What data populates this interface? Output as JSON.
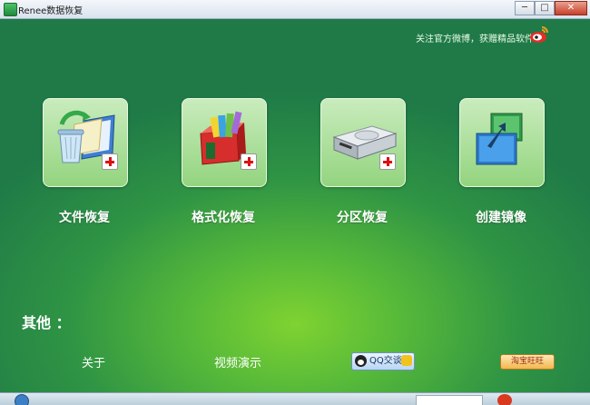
{
  "window": {
    "title": "Renee数据恢复",
    "minimize": "─",
    "maximize": "□",
    "close": "✕"
  },
  "header": {
    "weibo_text": "关注官方微博，获赠精品软件"
  },
  "tiles": [
    {
      "label": "文件恢复",
      "icon": "file-recovery-icon"
    },
    {
      "label": "格式化恢复",
      "icon": "format-recovery-icon"
    },
    {
      "label": "分区恢复",
      "icon": "partition-recovery-icon"
    },
    {
      "label": "创建镜像",
      "icon": "create-image-icon"
    }
  ],
  "other": {
    "title": "其他 ：",
    "about": "关于",
    "video_demo": "视频演示",
    "qq_label": "QQ交谈",
    "taobao_label": "淘宝旺旺"
  },
  "colors": {
    "background_center": "#7fd331",
    "background_edge": "#1f7a47",
    "tile_fill": "#b5e3a6",
    "plus_red": "#dd1111"
  }
}
